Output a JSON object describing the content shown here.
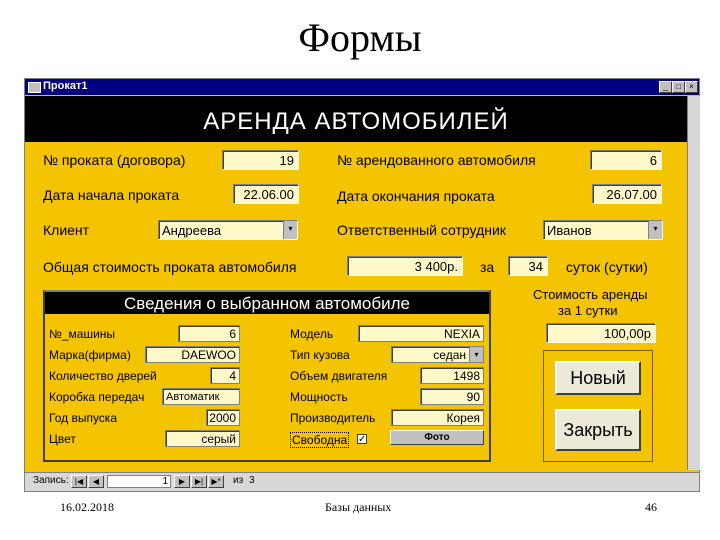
{
  "slide": {
    "title": "Формы",
    "footer_date": "16.02.2018",
    "footer_center": "Базы данных",
    "footer_page": "46"
  },
  "window": {
    "title": "Прокат1",
    "min_glyph": "_",
    "max_glyph": "□",
    "close_glyph": "×"
  },
  "form": {
    "header": "АРЕНДА   АВТОМОБИЛЕЙ",
    "rental_no_label": "№ проката (договора)",
    "rental_no": "19",
    "car_no_label": "№ арендованного автомобиля",
    "car_no": "6",
    "start_label": "Дата начала проката",
    "start_date": "22.06.00",
    "end_label": "Дата окончания проката",
    "end_date": "26.07.00",
    "client_label": "Клиент",
    "client": "Андреева",
    "employee_label": "Ответственный сотрудник",
    "employee": "Иванов",
    "total_label": "Общая стоимость проката автомобиля",
    "total": "3 400р.",
    "for_label": "за",
    "days": "34",
    "days_label": "суток (сутки)",
    "daily_cost_label_1": "Стоимость аренды",
    "daily_cost_label_2": "за 1 сутки",
    "daily_cost": "100,00р"
  },
  "subform": {
    "header": "Сведения о выбранном автомобиле",
    "car_no_label": "№_машины",
    "car_no": "6",
    "brand_label": "Марка(фирма)",
    "brand": "DAEWOO",
    "doors_label": "Количество дверей",
    "doors": "4",
    "gearbox_label": "Коробка передач",
    "gearbox": "Автоматик",
    "year_label": "Год выпуска",
    "year": "2000",
    "color_label": "Цвет",
    "color": "серый",
    "model_label": "Модель",
    "model": "NEXIA",
    "body_label": "Тип кузова",
    "body": "седан",
    "engine_label": "Объем двигателя",
    "engine": "1498",
    "power_label": "Мощность",
    "power": "90",
    "maker_label": "Производитель",
    "maker": "Корея",
    "free_label": "Свободна",
    "free_check": "✓",
    "photo_label": "Фото"
  },
  "buttons": {
    "new": "Новый",
    "close": "Закрыть"
  },
  "nav": {
    "records_label": "Запись:",
    "current": "1",
    "of_label": "из",
    "total": "3",
    "first": "|◀",
    "prev": "◀",
    "next": "▶",
    "last": "▶|",
    "new": "▶*"
  },
  "icons": {
    "dropdown": "▾"
  }
}
